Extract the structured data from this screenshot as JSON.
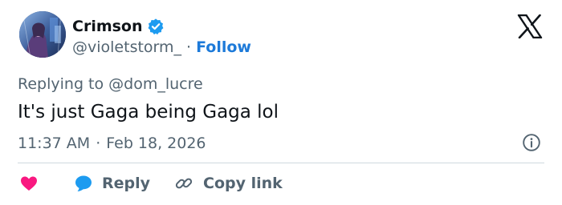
{
  "tweet": {
    "author": {
      "display_name": "Crimson",
      "handle": "@violetstorm_",
      "verified": true,
      "avatar_icon": "avatar-image"
    },
    "follow_label": "Follow",
    "separator": "·",
    "reply_context": "Replying to @dom_lucre",
    "text": "It's just Gaga being Gaga lol",
    "time": "11:37 AM",
    "date": "Feb 18, 2026",
    "platform_icon": "x-logo-icon"
  },
  "actions": {
    "like_icon": "heart-icon",
    "reply_label": "Reply",
    "copy_link_label": "Copy link"
  },
  "colors": {
    "text_primary": "#0f1419",
    "text_secondary": "#536471",
    "link_blue": "#1d7ad9",
    "verified_blue": "#1d9bf0",
    "like_pink": "#f91880",
    "divider": "#cfd9de"
  }
}
